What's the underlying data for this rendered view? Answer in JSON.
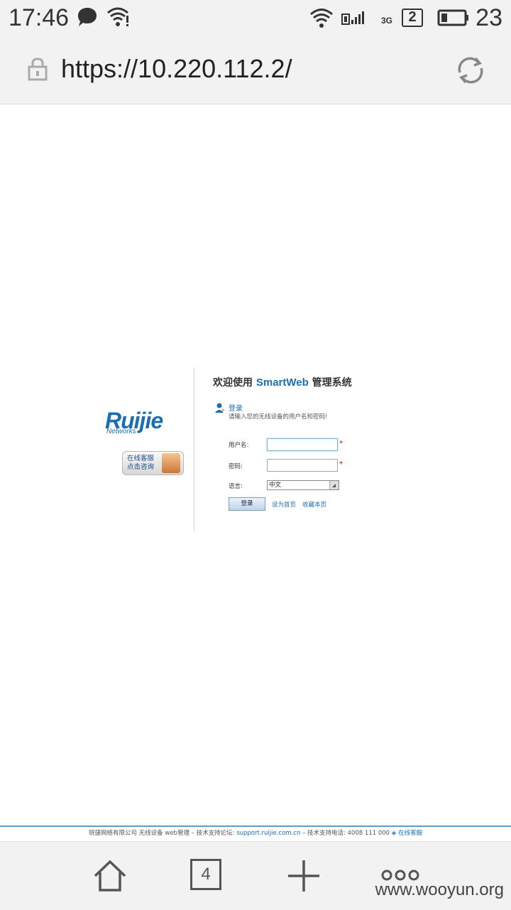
{
  "status_bar": {
    "time": "17:46",
    "sim_slot": "2",
    "network_type": "3G",
    "battery_level": "23"
  },
  "browser": {
    "url": "https://10.220.112.2/",
    "tab_count": "4"
  },
  "page": {
    "logo": {
      "text": "Ruijie",
      "sub": "Networks"
    },
    "service_button": {
      "line1": "在线客服",
      "line2": "点击咨询"
    },
    "welcome_prefix": "欢迎使用",
    "welcome_brand": "SmartWeb",
    "welcome_suffix": "管理系统",
    "login_title": "登录",
    "login_hint": "请输入您的无线设备的用户名和密码!",
    "form": {
      "username_label": "用户名:",
      "password_label": "密码:",
      "language_label": "语言:",
      "language_value": "中文",
      "required_mark": "*",
      "submit_label": "登录",
      "set_homepage_link": "设为首页",
      "bookmark_link": "收藏本页"
    },
    "footer": {
      "text_prefix": "锐捷网络有限公司 无线设备 web管理 – 技术支持论坛:",
      "support_url": "support.ruijie.com.cn",
      "text_middle": "– 技术支持电话: 4008 111 000",
      "online_service": "在线客服"
    }
  },
  "watermark": "www.wooyun.org"
}
